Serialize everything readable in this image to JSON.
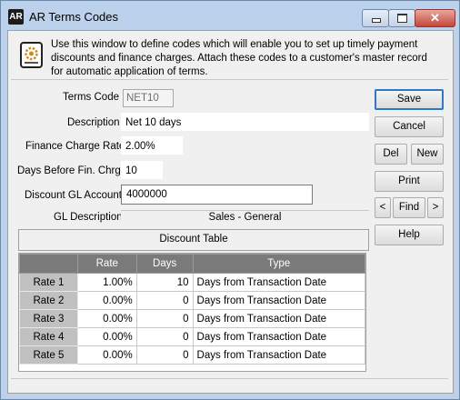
{
  "window": {
    "app_badge": "AR",
    "title": "AR Terms Codes",
    "close_glyph": "✕"
  },
  "info": {
    "text": "Use this window to define codes which will enable you to set up timely payment discounts and finance charges.  Attach these codes to a customer's master record for automatic application of terms."
  },
  "form": {
    "terms_code_label": "Terms Code",
    "terms_code_value": "NET10",
    "description_label": "Description",
    "description_value": "Net 10 days",
    "finance_rate_label": "Finance Charge Rate",
    "finance_rate_value": "2.00%",
    "days_label": "Days Before Fin. Chrg.",
    "days_value": "10",
    "gl_account_label": "Discount GL Account",
    "gl_account_value": "4000000",
    "gl_desc_label": "GL Description",
    "gl_desc_value": "Sales - General"
  },
  "discount_table": {
    "title": "Discount Table",
    "headers": [
      "",
      "Rate",
      "Days",
      "Type"
    ],
    "rows": [
      {
        "name": "Rate 1",
        "rate": "1.00%",
        "days": "10",
        "type": "Days from Transaction Date"
      },
      {
        "name": "Rate 2",
        "rate": "0.00%",
        "days": "0",
        "type": "Days from Transaction Date"
      },
      {
        "name": "Rate 3",
        "rate": "0.00%",
        "days": "0",
        "type": "Days from Transaction Date"
      },
      {
        "name": "Rate 4",
        "rate": "0.00%",
        "days": "0",
        "type": "Days from Transaction Date"
      },
      {
        "name": "Rate 5",
        "rate": "0.00%",
        "days": "0",
        "type": "Days from Transaction Date"
      }
    ]
  },
  "buttons": {
    "save": "Save",
    "cancel": "Cancel",
    "del": "Del",
    "new": "New",
    "print": "Print",
    "prev": "<",
    "find": "Find",
    "next": ">",
    "help": "Help"
  },
  "icons": {
    "app": "ar-app-icon",
    "info": "document-gear-icon"
  }
}
